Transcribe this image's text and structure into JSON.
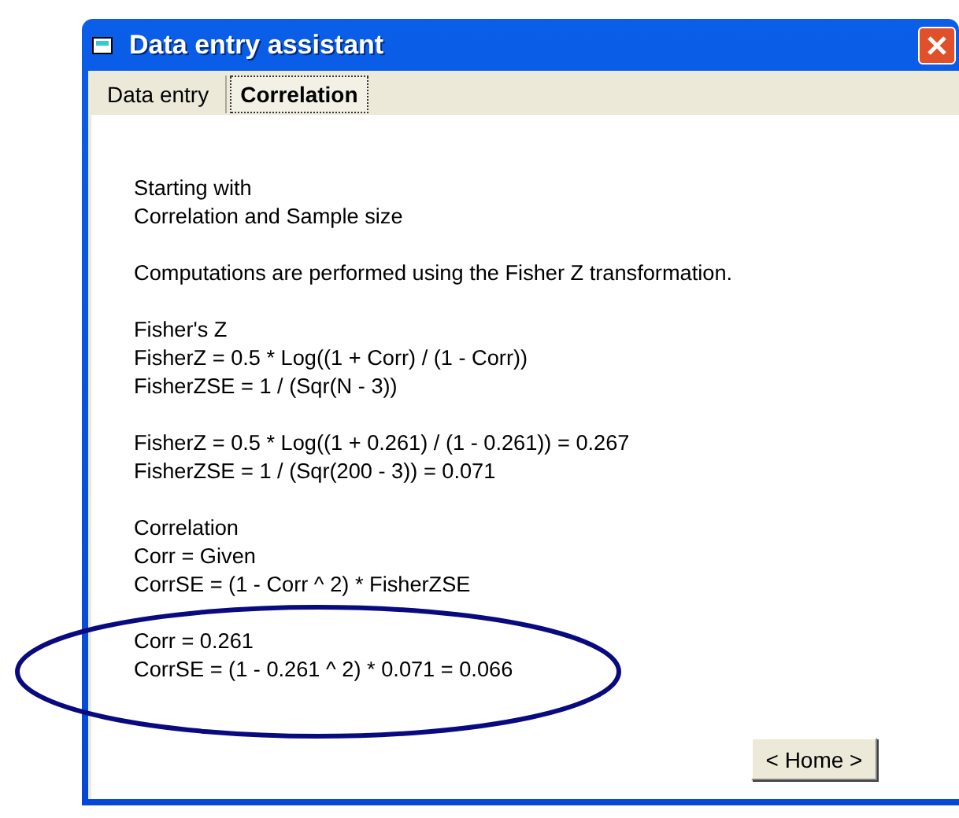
{
  "window": {
    "title": "Data entry assistant"
  },
  "tabs": [
    {
      "label": "Data entry",
      "selected": false
    },
    {
      "label": "Correlation",
      "selected": true
    }
  ],
  "paragraphs": [
    [
      "Starting with",
      "Correlation and Sample size"
    ],
    [
      "Computations are performed using the Fisher Z transformation."
    ],
    [
      "Fisher's Z",
      "FisherZ = 0.5 * Log((1 + Corr) / (1 - Corr))",
      "FisherZSE = 1 / (Sqr(N - 3))"
    ],
    [
      "FisherZ = 0.5 * Log((1 + 0.261) / (1 - 0.261)) = 0.267",
      "FisherZSE = 1 / (Sqr(200 - 3)) = 0.071"
    ],
    [
      "Correlation",
      "Corr = Given",
      "CorrSE = (1 - Corr ^ 2) * FisherZSE"
    ],
    [
      "Corr = 0.261",
      "CorrSE = (1 - 0.261 ^ 2) * 0.071 = 0.066"
    ]
  ],
  "buttons": [
    "< Home >"
  ]
}
